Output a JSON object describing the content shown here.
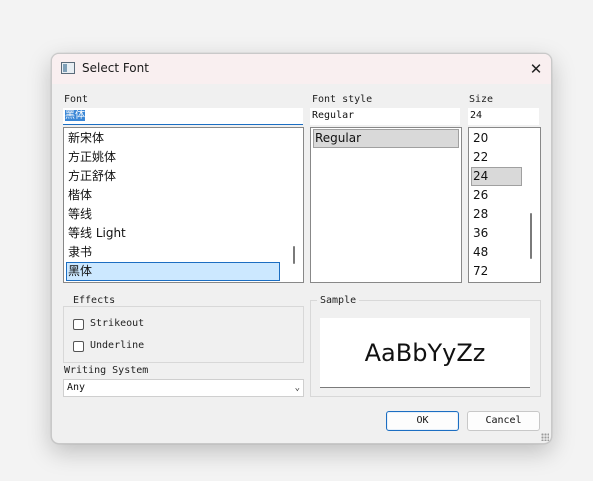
{
  "window": {
    "title": "Select Font",
    "close_icon": "close-icon"
  },
  "font": {
    "label": "Font",
    "value": "黑体",
    "items": [
      "新宋体",
      "方正姚体",
      "方正舒体",
      "楷体",
      "等线",
      "等线 Light",
      "隶书",
      "黑体"
    ],
    "selected": "黑体"
  },
  "style": {
    "label": "Font style",
    "value": "Regular",
    "items": [
      "Regular"
    ],
    "selected": "Regular"
  },
  "size": {
    "label": "Size",
    "value": "24",
    "items": [
      "20",
      "22",
      "24",
      "26",
      "28",
      "36",
      "48",
      "72"
    ],
    "selected": "24"
  },
  "effects": {
    "title": "Effects",
    "strikeout": {
      "label": "Strikeout",
      "checked": false
    },
    "underline": {
      "label": "Underline",
      "checked": false
    }
  },
  "writing_system": {
    "label": "Writing System",
    "value": "Any"
  },
  "sample": {
    "title": "Sample",
    "text": "AaBbYyZz"
  },
  "buttons": {
    "ok": "OK",
    "cancel": "Cancel"
  },
  "colors": {
    "accent": "#1c6ec2",
    "selection_bg": "#cce8ff",
    "title_bar": "#f9eff0"
  }
}
